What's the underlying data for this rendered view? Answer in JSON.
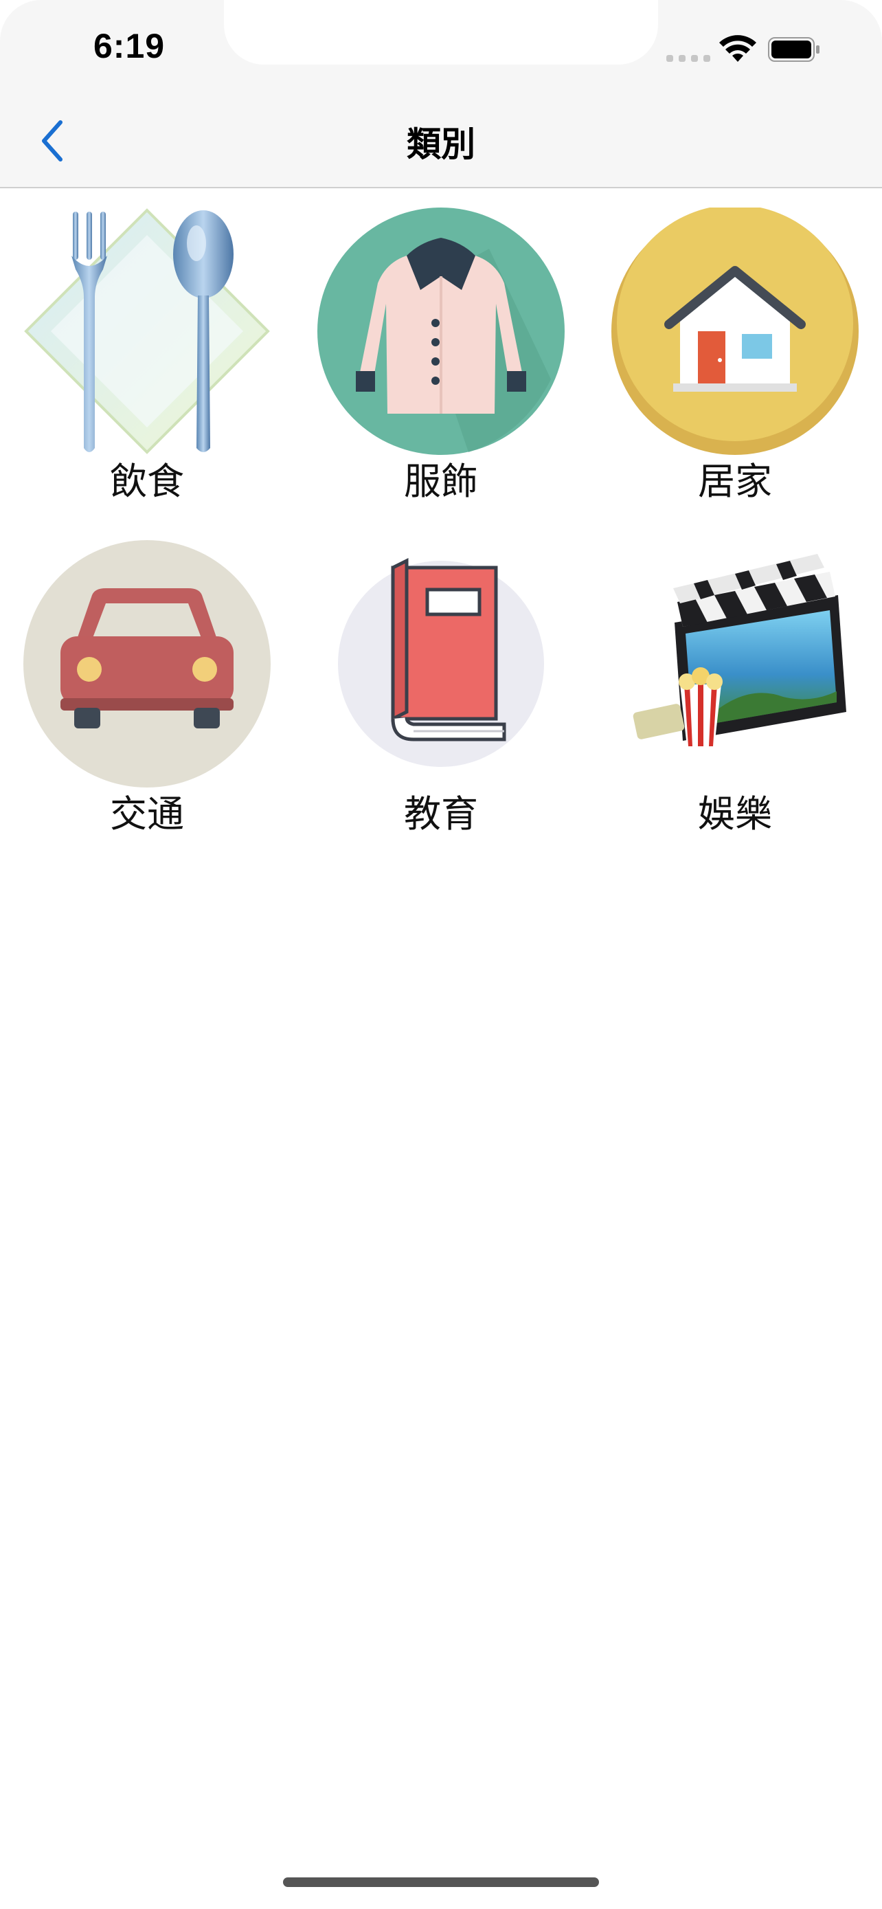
{
  "status_bar": {
    "time": "6:19"
  },
  "nav": {
    "title": "類別"
  },
  "categories": [
    {
      "label": "飲食",
      "icon": "fork-spoon-icon"
    },
    {
      "label": "服飾",
      "icon": "coat-icon"
    },
    {
      "label": "居家",
      "icon": "house-icon"
    },
    {
      "label": "交通",
      "icon": "car-icon"
    },
    {
      "label": "教育",
      "icon": "book-icon"
    },
    {
      "label": "娛樂",
      "icon": "movie-clapper-icon"
    }
  ],
  "colors": {
    "accent": "#1a6fd1",
    "nav_bg": "#f6f6f6"
  }
}
